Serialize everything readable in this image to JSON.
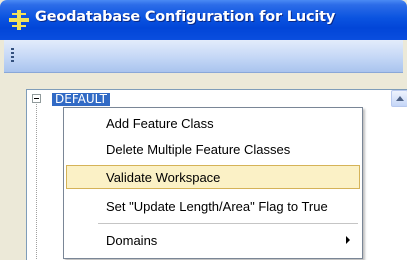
{
  "window": {
    "title": "Geodatabase Configuration for Lucity",
    "icon": "lucity-crosshair-icon"
  },
  "tree": {
    "root_label": "DEFAULT"
  },
  "context_menu": {
    "items": [
      {
        "label": "Add Feature Class"
      },
      {
        "label": "Delete Multiple Feature Classes"
      },
      {
        "label": "Validate Workspace",
        "highlighted": true
      },
      {
        "label": "Set \"Update Length/Area\" Flag to True"
      },
      {
        "label": "Domains",
        "submenu": true
      }
    ]
  },
  "colors": {
    "titlebar": "#0A53E0",
    "selection": "#316AC5",
    "menu_highlight": "#FBF1C6"
  }
}
